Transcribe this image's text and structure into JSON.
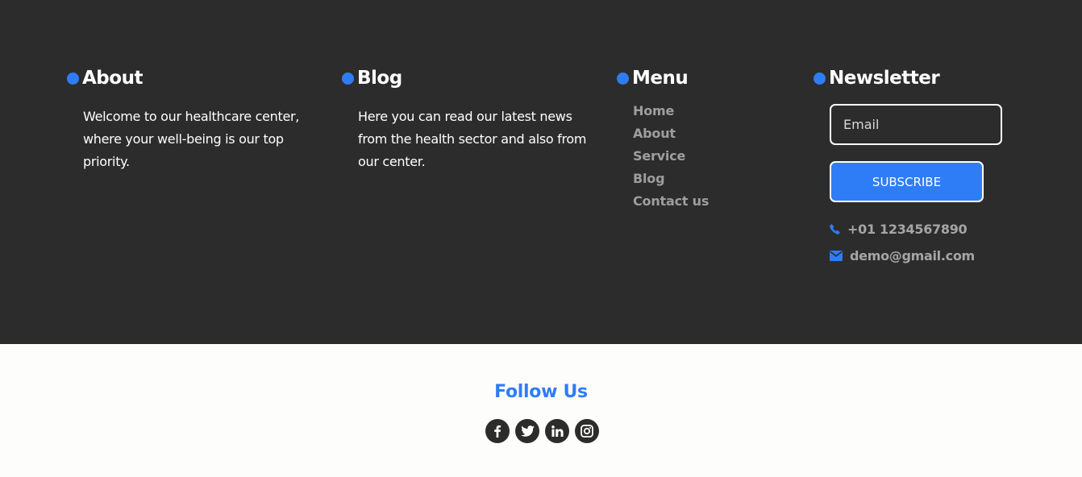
{
  "about": {
    "title": "About",
    "text": "Welcome to our healthcare center, where your well-being is our top priority."
  },
  "blog": {
    "title": "Blog",
    "text": "Here you can read our latest news from the health sector and also from our center."
  },
  "menu": {
    "title": "Menu",
    "items": [
      "Home",
      "About",
      "Service",
      "Blog",
      "Contact us"
    ]
  },
  "newsletter": {
    "title": "Newsletter",
    "email_placeholder": "Email",
    "subscribe_label": "SUBSCRIBE",
    "phone": "+01 1234567890",
    "email": "demo@gmail.com"
  },
  "follow": {
    "title": "Follow Us",
    "icons": [
      "facebook-icon",
      "twitter-icon",
      "linkedin-icon",
      "instagram-icon"
    ]
  },
  "colors": {
    "accent": "#2f7df6",
    "footer_bg": "#2c2c2c",
    "bottom_bg": "#fdfdfb",
    "menu_text": "#9e9e9e"
  }
}
